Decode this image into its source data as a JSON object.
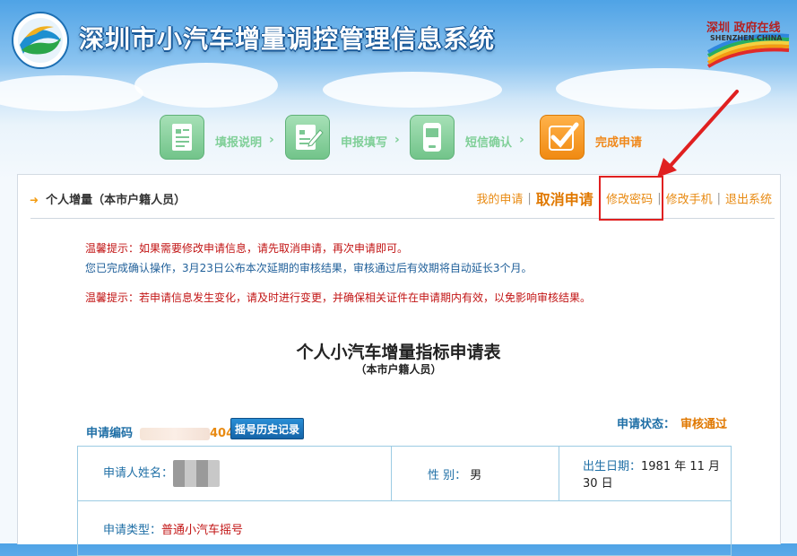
{
  "header": {
    "system_title": "深圳市小汽车增量调控管理信息系统",
    "city_logo_cn": "深圳 政府在线",
    "city_logo_en": "SHENZHEN CHINA"
  },
  "steps": [
    {
      "label": "填报说明",
      "icon": "document-list-icon",
      "active": false
    },
    {
      "label": "申报填写",
      "icon": "pen-form-icon",
      "active": false
    },
    {
      "label": "短信确认",
      "icon": "phone-icon",
      "active": false
    },
    {
      "label": "完成申请",
      "icon": "check-mark-icon",
      "active": true
    }
  ],
  "breadcrumb": "个人增量（本市户籍人员）",
  "nav": {
    "my_applications": "我的申请",
    "cancel_application": "取消申请",
    "change_password": "修改密码",
    "change_phone": "修改手机",
    "logout": "退出系统",
    "separator": "|"
  },
  "tips": {
    "tip1": "温馨提示：如果需要修改申请信息，请先取消申请，再次申请即可。",
    "tip2": "您已完成确认操作，3月23日公布本次延期的审核结果，审核通过后有效期将自动延长3个月。",
    "tip3": "温馨提示：若申请信息发生变化，请及时进行变更，并确保相关证件在申请期内有效，以免影响审核结果。"
  },
  "form": {
    "title": "个人小汽车增量指标申请表",
    "subtitle": "（本市户籍人员）",
    "app_no_label": "申请编码",
    "app_no_tail": "404",
    "history_button": "摇号历史记录",
    "status_label": "申请状态：",
    "status_value": "审核通过"
  },
  "info": {
    "name_label": "申请人姓名：",
    "gender_label": "性 别：",
    "gender_value": "男",
    "dob_label": "出生日期：",
    "dob_value": "1981 年 11 月 30 日",
    "type_label": "申请类型：",
    "type_value": "普通小汽车摇号"
  },
  "colors": {
    "accent": "#e07800",
    "link_blue": "#1f6fa6",
    "warning_red": "#c21515",
    "highlight": "#e02020"
  }
}
